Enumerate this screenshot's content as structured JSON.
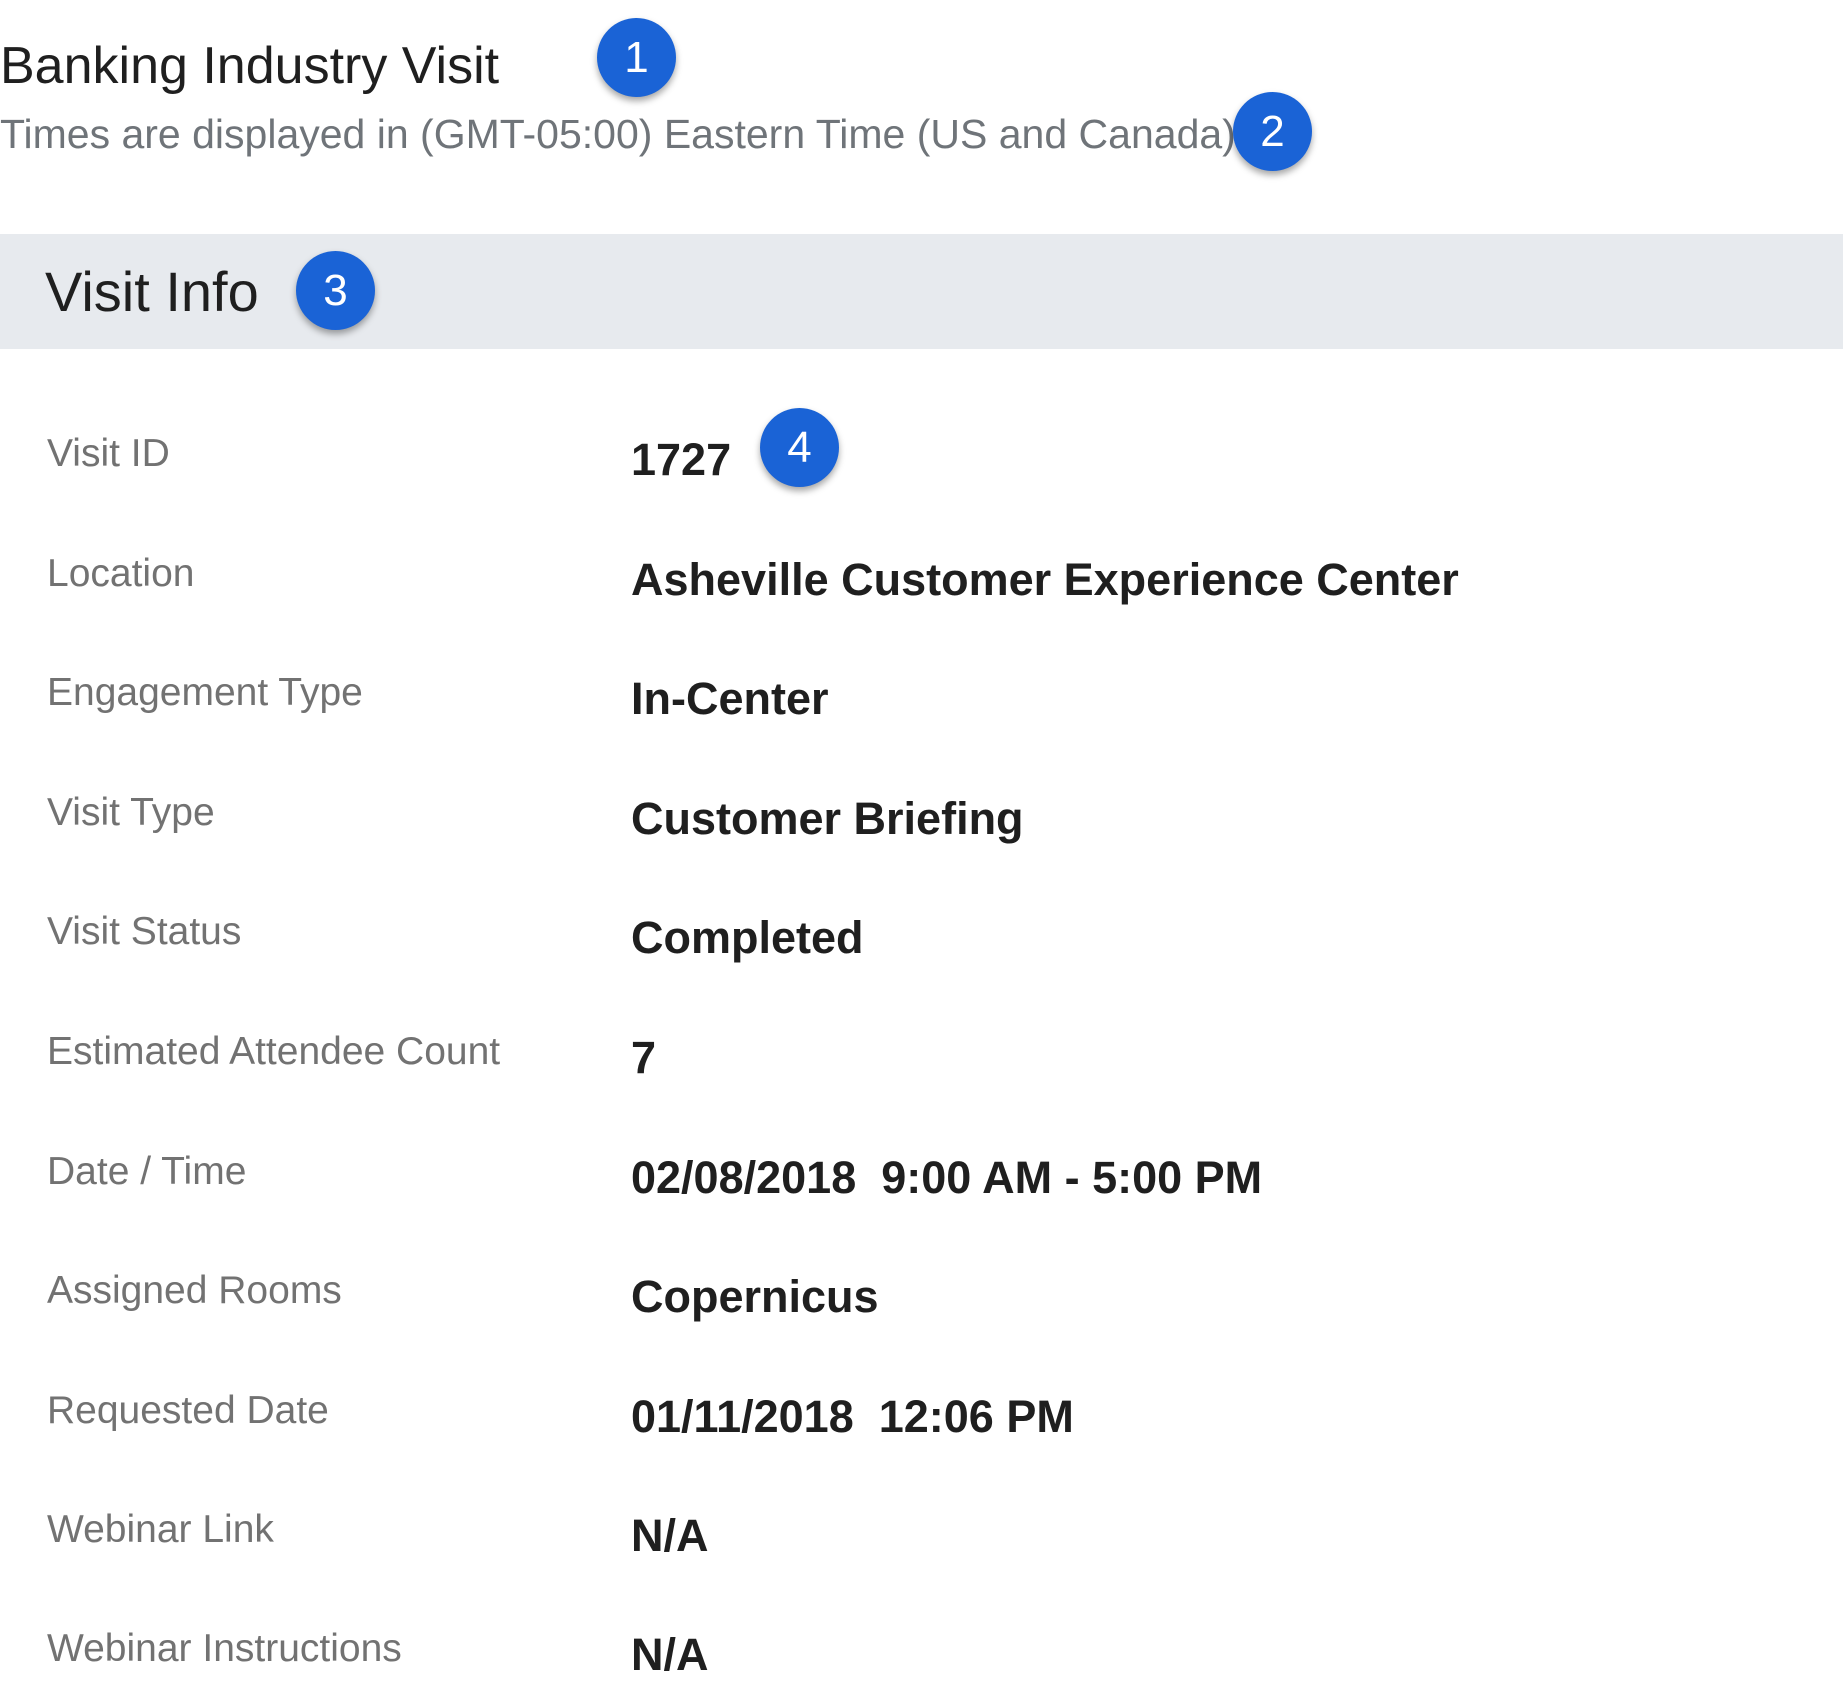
{
  "header": {
    "title": "Banking Industry Visit",
    "timezone_note": "Times are displayed in (GMT-05:00) Eastern Time (US and Canada)"
  },
  "badges": {
    "b1": "1",
    "b2": "2",
    "b3": "3",
    "b4": "4"
  },
  "visit_info": {
    "section_title": "Visit Info",
    "rows": [
      {
        "label": "Visit ID",
        "value": "1727"
      },
      {
        "label": "Location",
        "value": "Asheville Customer Experience Center"
      },
      {
        "label": "Engagement Type",
        "value": "In-Center"
      },
      {
        "label": "Visit Type",
        "value": "Customer Briefing"
      },
      {
        "label": "Visit Status",
        "value": "Completed"
      },
      {
        "label": "Estimated Attendee Count",
        "value": "7"
      },
      {
        "label": "Date / Time",
        "value": "02/08/2018  9:00 AM - 5:00 PM"
      },
      {
        "label": "Assigned Rooms",
        "value": "Copernicus"
      },
      {
        "label": "Requested Date",
        "value": "01/11/2018  12:06 PM"
      },
      {
        "label": "Webinar Link",
        "value": "N/A"
      },
      {
        "label": "Webinar Instructions",
        "value": "N/A"
      }
    ]
  },
  "colors": {
    "badge": "#1a63d6",
    "section_header_bg": "#e7eaee",
    "label_text": "#727272",
    "value_text": "#1f1f1f"
  }
}
